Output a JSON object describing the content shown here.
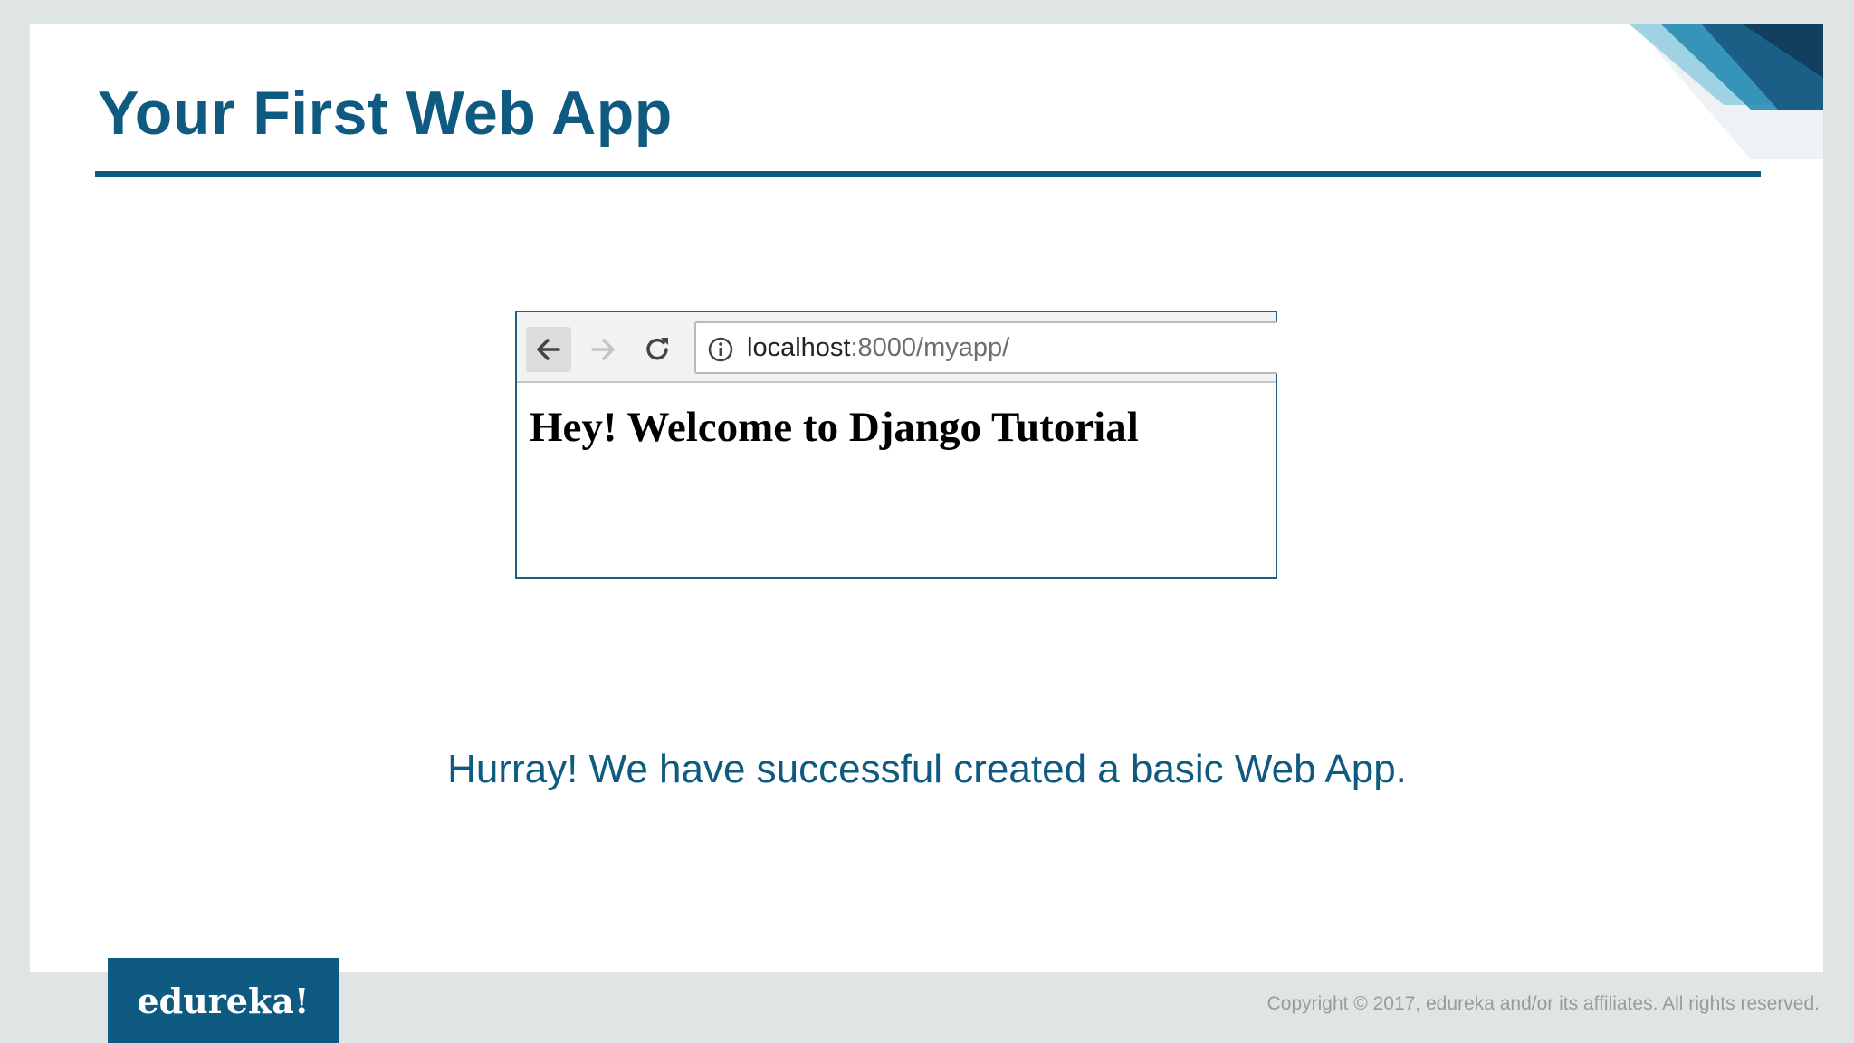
{
  "slide": {
    "title": "Your First Web App",
    "message": "Hurray! We have successful created a basic Web App."
  },
  "browser": {
    "url_host": "localhost",
    "url_path": ":8000/myapp/",
    "page_heading": "Hey! Welcome to Django Tutorial",
    "icons": [
      "back-arrow-icon",
      "forward-arrow-icon",
      "reload-icon",
      "info-icon"
    ]
  },
  "footer": {
    "logo": "edureka!",
    "copyright": "Copyright © 2017, edureka and/or its affiliates. All rights reserved."
  },
  "colors": {
    "brand_blue": "#0f5a80",
    "corner_teal": "#2b8db4",
    "background": "#dfe4e4"
  }
}
